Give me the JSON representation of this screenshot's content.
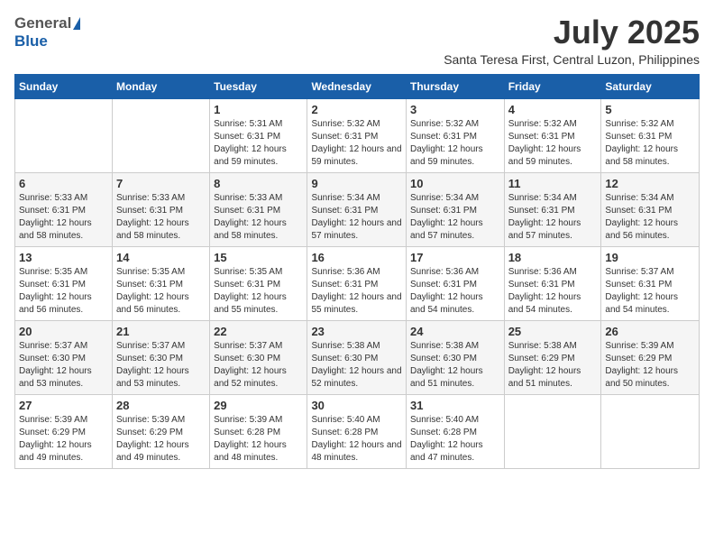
{
  "header": {
    "logo_general": "General",
    "logo_blue": "Blue",
    "month_title": "July 2025",
    "location": "Santa Teresa First, Central Luzon, Philippines"
  },
  "days_of_week": [
    "Sunday",
    "Monday",
    "Tuesday",
    "Wednesday",
    "Thursday",
    "Friday",
    "Saturday"
  ],
  "weeks": [
    {
      "cells": [
        {
          "day": "",
          "info": ""
        },
        {
          "day": "",
          "info": ""
        },
        {
          "day": "1",
          "info": "Sunrise: 5:31 AM\nSunset: 6:31 PM\nDaylight: 12 hours and 59 minutes."
        },
        {
          "day": "2",
          "info": "Sunrise: 5:32 AM\nSunset: 6:31 PM\nDaylight: 12 hours and 59 minutes."
        },
        {
          "day": "3",
          "info": "Sunrise: 5:32 AM\nSunset: 6:31 PM\nDaylight: 12 hours and 59 minutes."
        },
        {
          "day": "4",
          "info": "Sunrise: 5:32 AM\nSunset: 6:31 PM\nDaylight: 12 hours and 59 minutes."
        },
        {
          "day": "5",
          "info": "Sunrise: 5:32 AM\nSunset: 6:31 PM\nDaylight: 12 hours and 58 minutes."
        }
      ]
    },
    {
      "cells": [
        {
          "day": "6",
          "info": "Sunrise: 5:33 AM\nSunset: 6:31 PM\nDaylight: 12 hours and 58 minutes."
        },
        {
          "day": "7",
          "info": "Sunrise: 5:33 AM\nSunset: 6:31 PM\nDaylight: 12 hours and 58 minutes."
        },
        {
          "day": "8",
          "info": "Sunrise: 5:33 AM\nSunset: 6:31 PM\nDaylight: 12 hours and 58 minutes."
        },
        {
          "day": "9",
          "info": "Sunrise: 5:34 AM\nSunset: 6:31 PM\nDaylight: 12 hours and 57 minutes."
        },
        {
          "day": "10",
          "info": "Sunrise: 5:34 AM\nSunset: 6:31 PM\nDaylight: 12 hours and 57 minutes."
        },
        {
          "day": "11",
          "info": "Sunrise: 5:34 AM\nSunset: 6:31 PM\nDaylight: 12 hours and 57 minutes."
        },
        {
          "day": "12",
          "info": "Sunrise: 5:34 AM\nSunset: 6:31 PM\nDaylight: 12 hours and 56 minutes."
        }
      ]
    },
    {
      "cells": [
        {
          "day": "13",
          "info": "Sunrise: 5:35 AM\nSunset: 6:31 PM\nDaylight: 12 hours and 56 minutes."
        },
        {
          "day": "14",
          "info": "Sunrise: 5:35 AM\nSunset: 6:31 PM\nDaylight: 12 hours and 56 minutes."
        },
        {
          "day": "15",
          "info": "Sunrise: 5:35 AM\nSunset: 6:31 PM\nDaylight: 12 hours and 55 minutes."
        },
        {
          "day": "16",
          "info": "Sunrise: 5:36 AM\nSunset: 6:31 PM\nDaylight: 12 hours and 55 minutes."
        },
        {
          "day": "17",
          "info": "Sunrise: 5:36 AM\nSunset: 6:31 PM\nDaylight: 12 hours and 54 minutes."
        },
        {
          "day": "18",
          "info": "Sunrise: 5:36 AM\nSunset: 6:31 PM\nDaylight: 12 hours and 54 minutes."
        },
        {
          "day": "19",
          "info": "Sunrise: 5:37 AM\nSunset: 6:31 PM\nDaylight: 12 hours and 54 minutes."
        }
      ]
    },
    {
      "cells": [
        {
          "day": "20",
          "info": "Sunrise: 5:37 AM\nSunset: 6:30 PM\nDaylight: 12 hours and 53 minutes."
        },
        {
          "day": "21",
          "info": "Sunrise: 5:37 AM\nSunset: 6:30 PM\nDaylight: 12 hours and 53 minutes."
        },
        {
          "day": "22",
          "info": "Sunrise: 5:37 AM\nSunset: 6:30 PM\nDaylight: 12 hours and 52 minutes."
        },
        {
          "day": "23",
          "info": "Sunrise: 5:38 AM\nSunset: 6:30 PM\nDaylight: 12 hours and 52 minutes."
        },
        {
          "day": "24",
          "info": "Sunrise: 5:38 AM\nSunset: 6:30 PM\nDaylight: 12 hours and 51 minutes."
        },
        {
          "day": "25",
          "info": "Sunrise: 5:38 AM\nSunset: 6:29 PM\nDaylight: 12 hours and 51 minutes."
        },
        {
          "day": "26",
          "info": "Sunrise: 5:39 AM\nSunset: 6:29 PM\nDaylight: 12 hours and 50 minutes."
        }
      ]
    },
    {
      "cells": [
        {
          "day": "27",
          "info": "Sunrise: 5:39 AM\nSunset: 6:29 PM\nDaylight: 12 hours and 49 minutes."
        },
        {
          "day": "28",
          "info": "Sunrise: 5:39 AM\nSunset: 6:29 PM\nDaylight: 12 hours and 49 minutes."
        },
        {
          "day": "29",
          "info": "Sunrise: 5:39 AM\nSunset: 6:28 PM\nDaylight: 12 hours and 48 minutes."
        },
        {
          "day": "30",
          "info": "Sunrise: 5:40 AM\nSunset: 6:28 PM\nDaylight: 12 hours and 48 minutes."
        },
        {
          "day": "31",
          "info": "Sunrise: 5:40 AM\nSunset: 6:28 PM\nDaylight: 12 hours and 47 minutes."
        },
        {
          "day": "",
          "info": ""
        },
        {
          "day": "",
          "info": ""
        }
      ]
    }
  ]
}
